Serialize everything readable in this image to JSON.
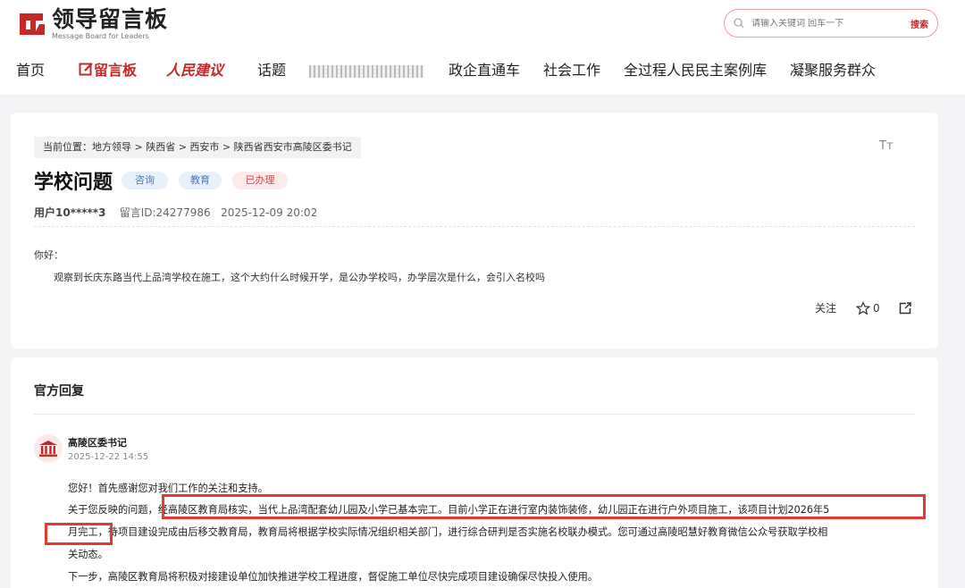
{
  "header": {
    "logo_title": "领导留言板",
    "logo_subtitle": "Message Board for Leaders",
    "search_placeholder": "请输入关键词 回车一下",
    "search_button": "搜索"
  },
  "nav": {
    "items": [
      "首页",
      "留言板",
      "人民建议",
      "话题",
      "政企直通车",
      "社会工作",
      "全过程人民民主案例库",
      "凝聚服务群众"
    ]
  },
  "breadcrumb": "当前位置：地方领导 > 陕西省 > 西安市 > 陕西省西安市高陵区委书记",
  "font_toggle": "Tт",
  "question": {
    "title": "学校问题",
    "tags": [
      "咨询",
      "教育",
      "已办理"
    ],
    "user": "用户10*****3",
    "id": "留言ID:24277986",
    "time": "2025-12-09 20:02",
    "greeting": "你好：",
    "body": "观察到长庆东路当代上品湾学校在施工，这个大约什么时候开学，是公办学校吗，办学层次是什么，会引入名校吗",
    "follow_label": "关注",
    "star_count": "0"
  },
  "reply": {
    "section_title": "官方回复",
    "responder": "高陵区委书记",
    "date": "2025-12-22 14:55",
    "line1": "您好！首先感谢您对我们工作的关注和支持。",
    "line2": "关于您反映的问题，经高陵区教育局核实，当代上品湾配套幼儿园及小学已基本完工。目前小学正在进行室内装饰装修，幼儿园正在进行户外项目施工，该项目计划2026年5",
    "line3": "月完工，待项目建设完成由后移交教育局，教育局将根据学校实际情况组织相关部门，进行综合研判是否实施名校联办模式。您可通过高陵昭慧好教育微信公众号获取学校相",
    "line4": "关动态。",
    "line5": "下一步，高陵区教育局将积极对接建设单位加快推进学校工程进度，督促施工单位尽快完成项目建设确保尽快投入使用。"
  },
  "colors": {
    "brand_red": "#c62828",
    "highlight_box": "#e53935",
    "tag_blue_bg": "#e8f0fb",
    "tag_red_bg": "#fdeaea"
  }
}
